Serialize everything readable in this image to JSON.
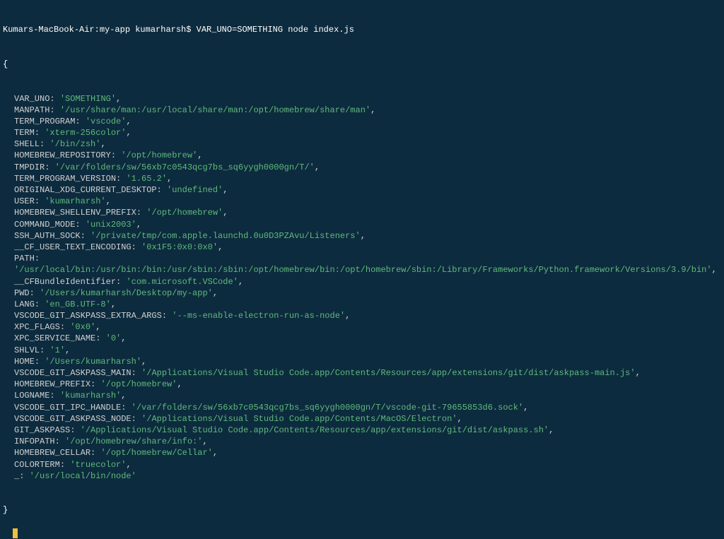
{
  "prompt": {
    "host_path": "Kumars-MacBook-Air:my-app kumarharsh$",
    "command": "VAR_UNO=SOMETHING node index.js"
  },
  "open_brace": "{",
  "close_brace": "}",
  "env": [
    {
      "key": "VAR_UNO",
      "value": "'SOMETHING'"
    },
    {
      "key": "MANPATH",
      "value": "'/usr/share/man:/usr/local/share/man:/opt/homebrew/share/man'"
    },
    {
      "key": "TERM_PROGRAM",
      "value": "'vscode'"
    },
    {
      "key": "TERM",
      "value": "'xterm-256color'"
    },
    {
      "key": "SHELL",
      "value": "'/bin/zsh'"
    },
    {
      "key": "HOMEBREW_REPOSITORY",
      "value": "'/opt/homebrew'"
    },
    {
      "key": "TMPDIR",
      "value": "'/var/folders/sw/56xb7c0543qcg7bs_sq6yygh0000gn/T/'"
    },
    {
      "key": "TERM_PROGRAM_VERSION",
      "value": "'1.65.2'"
    },
    {
      "key": "ORIGINAL_XDG_CURRENT_DESKTOP",
      "value": "'undefined'"
    },
    {
      "key": "USER",
      "value": "'kumarharsh'"
    },
    {
      "key": "HOMEBREW_SHELLENV_PREFIX",
      "value": "'/opt/homebrew'"
    },
    {
      "key": "COMMAND_MODE",
      "value": "'unix2003'"
    },
    {
      "key": "SSH_AUTH_SOCK",
      "value": "'/private/tmp/com.apple.launchd.0u0D3PZAvu/Listeners'"
    },
    {
      "key": "__CF_USER_TEXT_ENCODING",
      "value": "'0x1F5:0x0:0x0'"
    },
    {
      "key": "PATH",
      "value": "'/usr/local/bin:/usr/bin:/bin:/usr/sbin:/sbin:/opt/homebrew/bin:/opt/homebrew/sbin:/Library/Frameworks/Python.framework/Versions/3.9/bin'"
    },
    {
      "key": "__CFBundleIdentifier",
      "value": "'com.microsoft.VSCode'"
    },
    {
      "key": "PWD",
      "value": "'/Users/kumarharsh/Desktop/my-app'"
    },
    {
      "key": "LANG",
      "value": "'en_GB.UTF-8'"
    },
    {
      "key": "VSCODE_GIT_ASKPASS_EXTRA_ARGS",
      "value": "'--ms-enable-electron-run-as-node'"
    },
    {
      "key": "XPC_FLAGS",
      "value": "'0x0'"
    },
    {
      "key": "XPC_SERVICE_NAME",
      "value": "'0'"
    },
    {
      "key": "SHLVL",
      "value": "'1'"
    },
    {
      "key": "HOME",
      "value": "'/Users/kumarharsh'"
    },
    {
      "key": "VSCODE_GIT_ASKPASS_MAIN",
      "value": "'/Applications/Visual Studio Code.app/Contents/Resources/app/extensions/git/dist/askpass-main.js'"
    },
    {
      "key": "HOMEBREW_PREFIX",
      "value": "'/opt/homebrew'"
    },
    {
      "key": "LOGNAME",
      "value": "'kumarharsh'"
    },
    {
      "key": "VSCODE_GIT_IPC_HANDLE",
      "value": "'/var/folders/sw/56xb7c0543qcg7bs_sq6yygh0000gn/T/vscode-git-79655853d6.sock'"
    },
    {
      "key": "VSCODE_GIT_ASKPASS_NODE",
      "value": "'/Applications/Visual Studio Code.app/Contents/MacOS/Electron'"
    },
    {
      "key": "GIT_ASKPASS",
      "value": "'/Applications/Visual Studio Code.app/Contents/Resources/app/extensions/git/dist/askpass.sh'"
    },
    {
      "key": "INFOPATH",
      "value": "'/opt/homebrew/share/info:'"
    },
    {
      "key": "HOMEBREW_CELLAR",
      "value": "'/opt/homebrew/Cellar'"
    },
    {
      "key": "COLORTERM",
      "value": "'truecolor'"
    },
    {
      "key": "_",
      "value": "'/usr/local/bin/node'"
    }
  ]
}
